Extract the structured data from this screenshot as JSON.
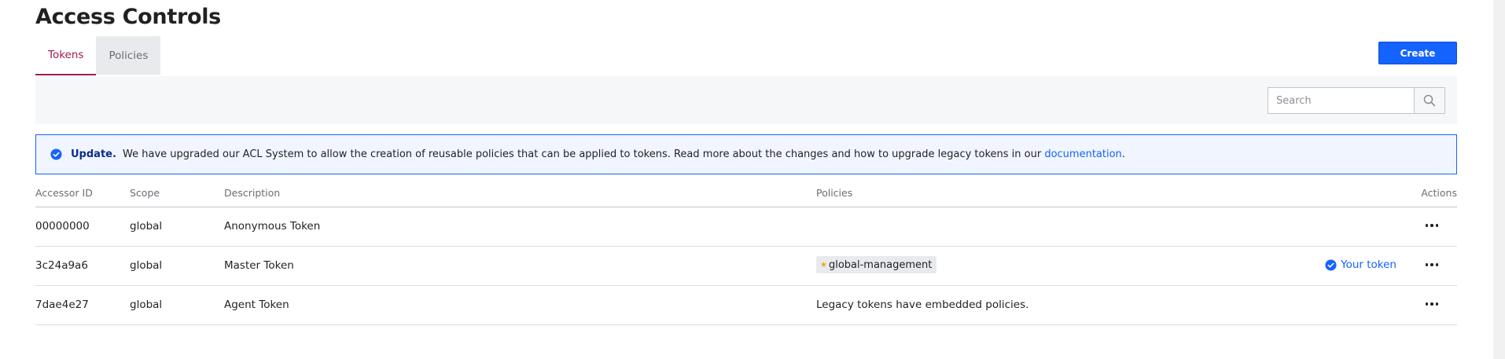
{
  "page": {
    "title": "Access Controls"
  },
  "tabs": [
    {
      "label": "Tokens",
      "active": true
    },
    {
      "label": "Policies",
      "active": false
    }
  ],
  "create_label": "Create",
  "search": {
    "placeholder": "Search",
    "value": "",
    "icon": "search-icon"
  },
  "notice": {
    "icon": "check-circle-icon",
    "bold": "Update.",
    "text": " We have upgraded our ACL System to allow the creation of reusable policies that can be applied to tokens. Read more about the changes and how to upgrade legacy tokens in our ",
    "link": "documentation",
    "end": "."
  },
  "table": {
    "headers": {
      "accessor": "Accessor ID",
      "scope": "Scope",
      "description": "Description",
      "policies": "Policies",
      "actions": "Actions"
    },
    "rows": [
      {
        "accessor": "00000000",
        "scope": "global",
        "description": "Anonymous Token",
        "policies": ""
      },
      {
        "accessor": "3c24a9a6",
        "scope": "global",
        "description": "Master Token",
        "policy_pill": "global-management",
        "your_token": "Your token"
      },
      {
        "accessor": "7dae4e27",
        "scope": "global",
        "description": "Agent Token",
        "policies": "Legacy tokens have embedded policies."
      }
    ]
  },
  "colors": {
    "accent": "#a01b51",
    "primary": "#1563ff",
    "star": "#f5a623"
  }
}
